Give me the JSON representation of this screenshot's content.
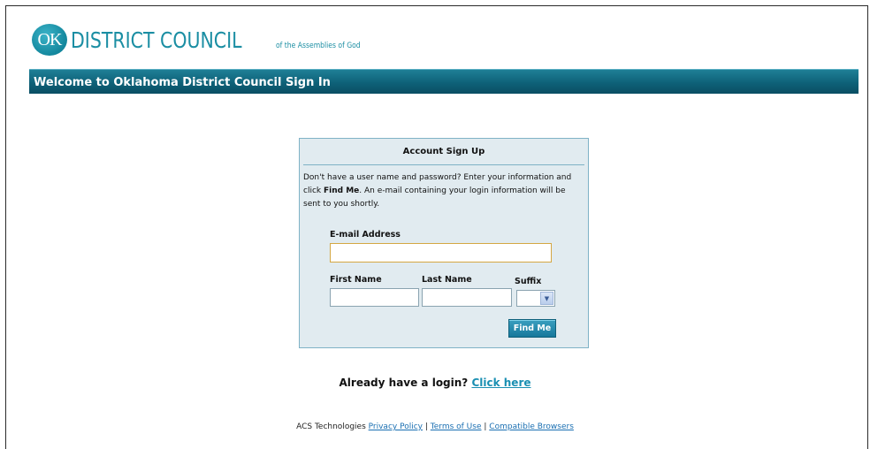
{
  "logo": {
    "badge": "OK",
    "main": "DISTRICT COUNCIL",
    "sub": "of the Assemblies of God"
  },
  "header": {
    "title": "Welcome to Oklahoma District Council Sign In"
  },
  "signup": {
    "title": "Account Sign Up",
    "intro_before": "Don't have a user name and password? Enter your information and click ",
    "intro_bold": "Find Me",
    "intro_after": ". An e-mail containing your login information will be sent to you shortly.",
    "email_label": "E-mail Address",
    "email_value": "",
    "first_name_label": "First Name",
    "first_name_value": "",
    "last_name_label": "Last Name",
    "last_name_value": "",
    "suffix_label": "Suffix",
    "suffix_value": "",
    "find_button": "Find Me"
  },
  "login_prompt": {
    "text": "Already have a login?",
    "link": "Click here"
  },
  "footer": {
    "company": "ACS Technologies",
    "privacy": "Privacy Policy",
    "terms": "Terms of Use",
    "browsers": "Compatible Browsers",
    "separator": "|"
  },
  "colors": {
    "brand_teal": "#1b8ea3",
    "header_bar": "#0e6178",
    "panel_bg": "#e1ebf0",
    "focus_border": "#d4a743",
    "link": "#1a8fb2"
  }
}
